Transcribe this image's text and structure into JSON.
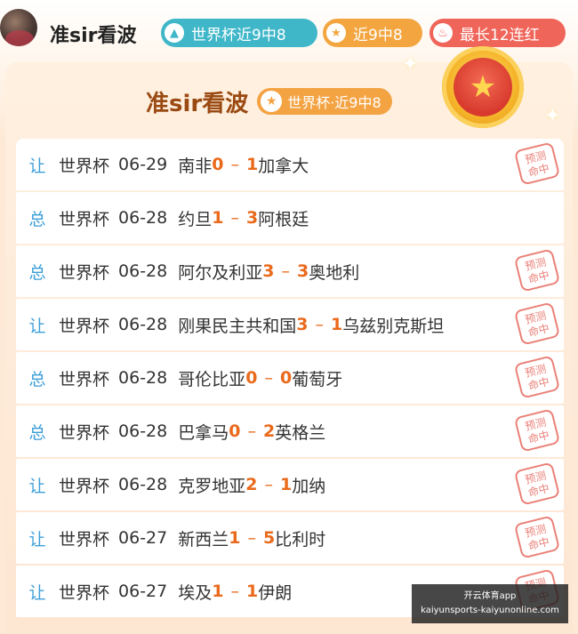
{
  "header": {
    "username": "准sir看波",
    "badges": [
      {
        "label": "世界杯近9中8",
        "icon": "arrow-up-icon"
      },
      {
        "label": "近9中8",
        "icon": "star-icon"
      },
      {
        "label": "最长12连红",
        "icon": "flame-icon"
      }
    ]
  },
  "card": {
    "title": "准sir看波",
    "pill": "世界杯·近9中8"
  },
  "matches": [
    {
      "type": "让",
      "league": "世界杯",
      "date": "06-29",
      "home": "南非",
      "home_score": "0",
      "away_score": "1",
      "away": "加拿大",
      "hit": true
    },
    {
      "type": "总",
      "league": "世界杯",
      "date": "06-28",
      "home": "约旦",
      "home_score": "1",
      "away_score": "3",
      "away": "阿根廷",
      "hit": false
    },
    {
      "type": "总",
      "league": "世界杯",
      "date": "06-28",
      "home": "阿尔及利亚",
      "home_score": "3",
      "away_score": "3",
      "away": "奥地利",
      "hit": true
    },
    {
      "type": "让",
      "league": "世界杯",
      "date": "06-28",
      "home": "刚果民主共和国",
      "home_score": "3",
      "away_score": "1",
      "away": "乌兹别克斯坦",
      "hit": true
    },
    {
      "type": "总",
      "league": "世界杯",
      "date": "06-28",
      "home": "哥伦比亚",
      "home_score": "0",
      "away_score": "0",
      "away": "葡萄牙",
      "hit": true
    },
    {
      "type": "总",
      "league": "世界杯",
      "date": "06-28",
      "home": "巴拿马",
      "home_score": "0",
      "away_score": "2",
      "away": "英格兰",
      "hit": true
    },
    {
      "type": "让",
      "league": "世界杯",
      "date": "06-28",
      "home": "克罗地亚",
      "home_score": "2",
      "away_score": "1",
      "away": "加纳",
      "hit": true
    },
    {
      "type": "让",
      "league": "世界杯",
      "date": "06-27",
      "home": "新西兰",
      "home_score": "1",
      "away_score": "5",
      "away": "比利时",
      "hit": true
    },
    {
      "type": "让",
      "league": "世界杯",
      "date": "06-27",
      "home": "埃及",
      "home_score": "1",
      "away_score": "1",
      "away": "伊朗",
      "hit": true
    }
  ],
  "stamp_text": "预测命中",
  "watermark": {
    "line1": "开云体育app",
    "line2": "kaiyunsports-kaiyunonline.com"
  }
}
